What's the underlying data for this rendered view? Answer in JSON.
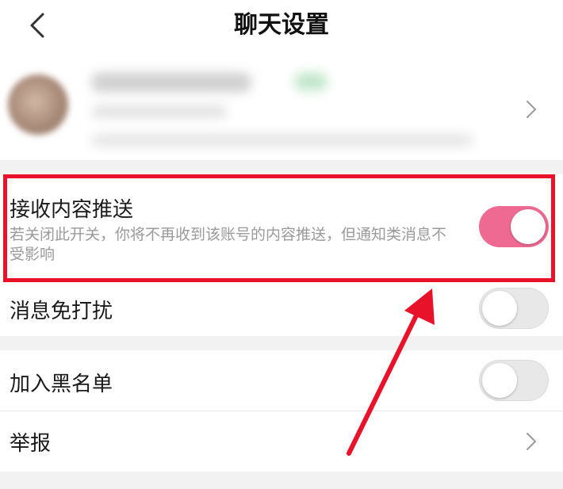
{
  "header": {
    "title": "聊天设置",
    "back_icon": "chevron-left-icon"
  },
  "profile": {
    "avatar_icon": "avatar",
    "name_blurred": true,
    "chevron_icon": "chevron-right-icon"
  },
  "settings": {
    "receive_push": {
      "label": "接收内容推送",
      "description": "若关闭此开关，你将不再收到该账号的内容推送，但通知类消息不受影响",
      "enabled": true
    },
    "do_not_disturb": {
      "label": "消息免打扰",
      "enabled": false
    },
    "blacklist": {
      "label": "加入黑名单",
      "enabled": false
    },
    "report": {
      "label": "举报",
      "chevron_icon": "chevron-right-icon"
    }
  },
  "colors": {
    "toggle_on": "#ee6a92",
    "toggle_off": "#e8e8e8",
    "annotation_red": "#e8132a",
    "background": "#f2f2f2"
  }
}
